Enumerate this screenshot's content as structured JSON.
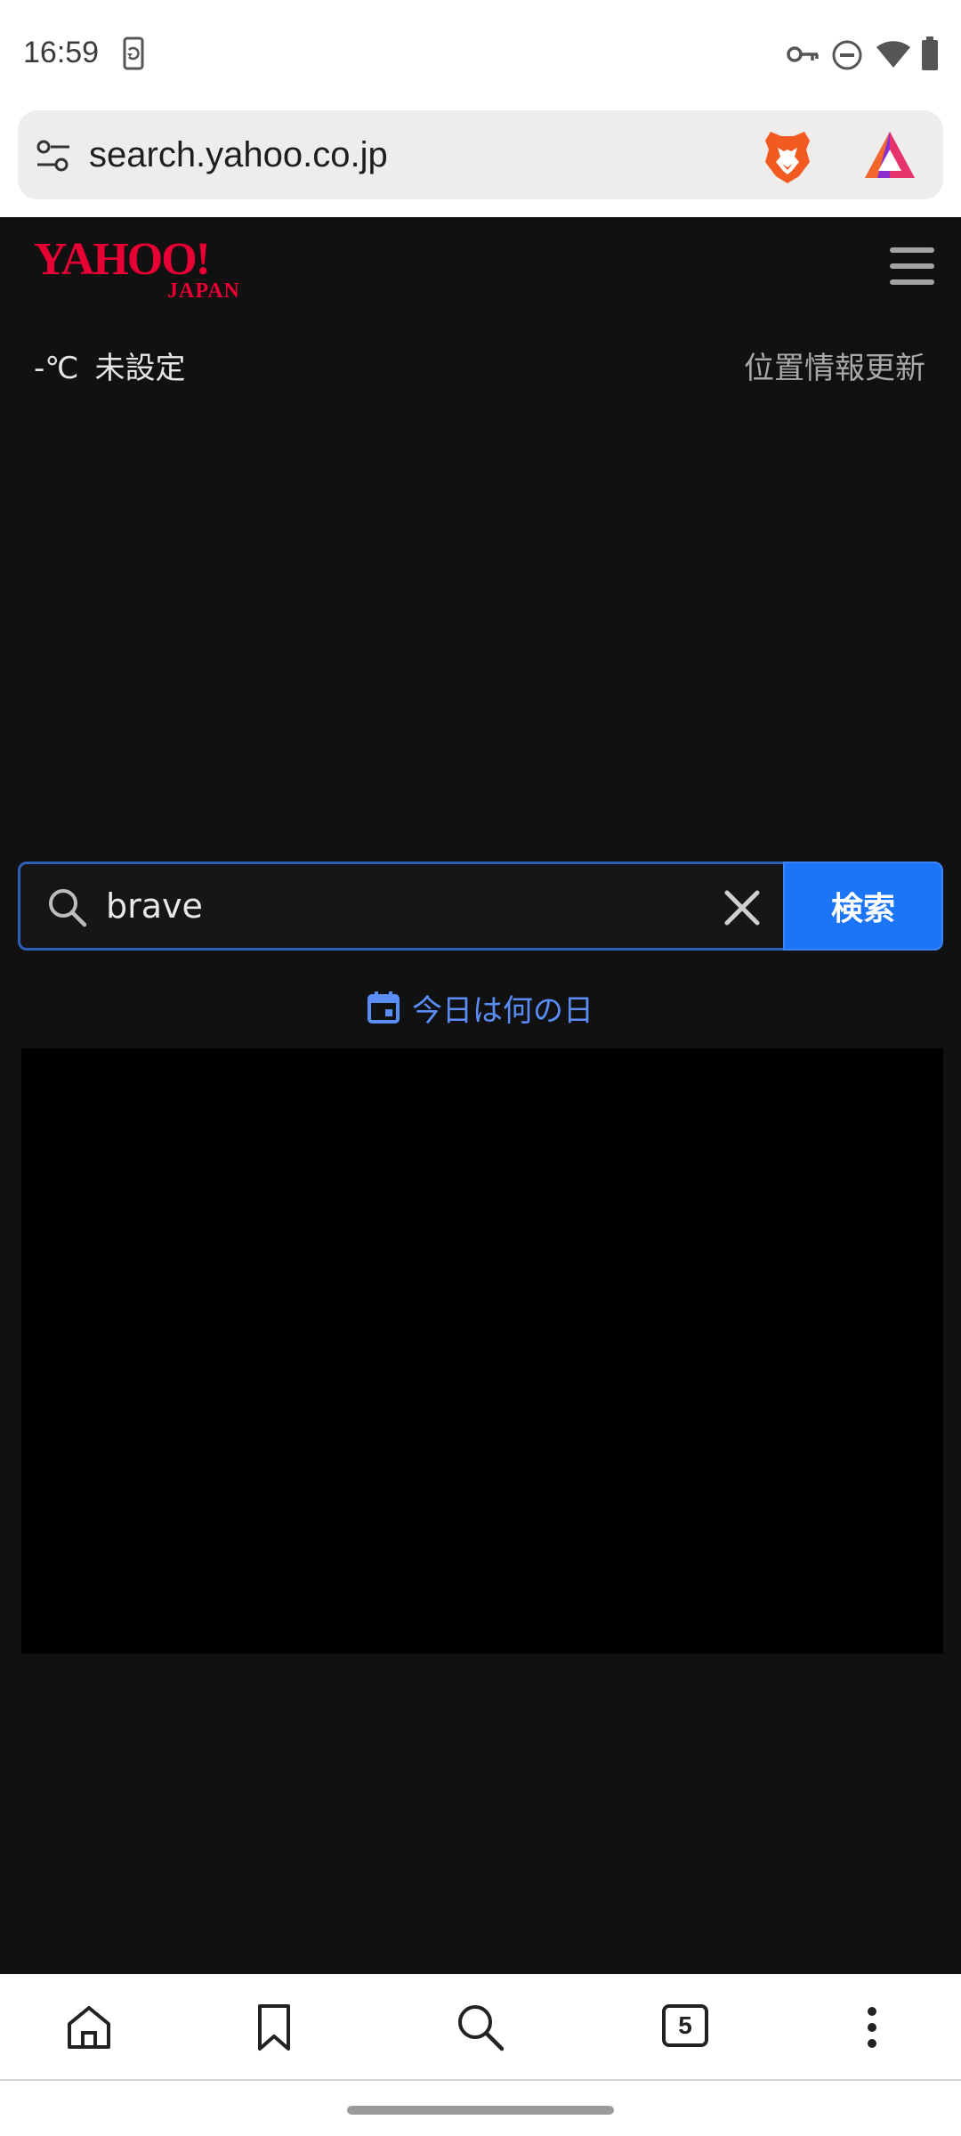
{
  "status_bar": {
    "time": "16:59",
    "icons": [
      "screen-rotate-icon",
      "vpn-key-icon",
      "do-not-disturb-icon",
      "wifi-icon",
      "battery-icon"
    ]
  },
  "browser": {
    "url": "search.yahoo.co.jp",
    "icons": [
      "site-settings-icon",
      "brave-lion-icon",
      "brave-rewards-icon"
    ]
  },
  "header": {
    "logo_text": "YAHOO!",
    "logo_subtext": "JAPAN",
    "menu_icon": "hamburger-menu-icon"
  },
  "weather": {
    "temperature": "-℃",
    "location": "未設定",
    "update_link": "位置情報更新"
  },
  "search": {
    "value": "brave",
    "button_label": "検索",
    "icon": "search-icon",
    "clear_icon": "clear-icon"
  },
  "today_link": {
    "label": "今日は何の日",
    "icon": "calendar-icon"
  },
  "toolbar": {
    "tab_count": "5",
    "icons": [
      "home-icon",
      "bookmark-icon",
      "search-icon",
      "tabs-icon",
      "more-vertical-icon"
    ]
  },
  "colors": {
    "page_background": "#111112",
    "yahoo_red": "#e60033",
    "search_button": "#1c74f6",
    "link_blue": "#5a8ef6",
    "search_border": "#2c5fb6"
  }
}
